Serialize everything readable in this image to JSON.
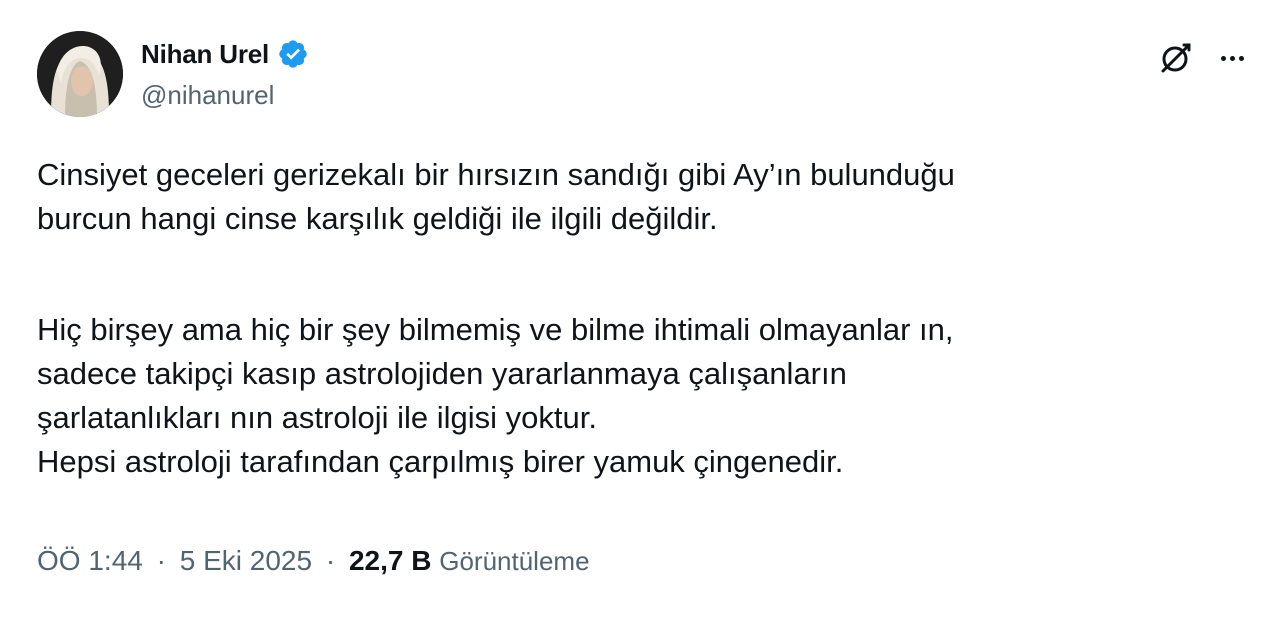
{
  "author": {
    "display_name": "Nihan Urel",
    "handle": "@nihanurel",
    "verified_color": "#1d9bf0"
  },
  "actions": {
    "grok_icon": "grok-icon",
    "more_icon": "more-icon"
  },
  "tweet": {
    "lines_1": [
      "Cinsiyet geceleri gerizekalı bir hırsızın sandığı gibi Ay’ın bulunduğu",
      "burcun hangi cinse karşılık geldiği ile ilgili değildir."
    ],
    "lines_2": [
      "Hiç birşey ama hiç bir şey bilmemiş ve bilme ihtimali olmayanlar ın,",
      "sadece takipçi kasıp astrolojiden yararlanmaya çalışanların",
      "şarlatanlıkları nın astroloji ile ilgisi yoktur.",
      "Hepsi astroloji tarafından çarpılmış birer yamuk çingenedir."
    ]
  },
  "meta": {
    "time": "ÖÖ 1:44",
    "date": "5 Eki 2025",
    "separator": "·",
    "views_count": "22,7 B",
    "views_label": "Görüntüleme"
  }
}
